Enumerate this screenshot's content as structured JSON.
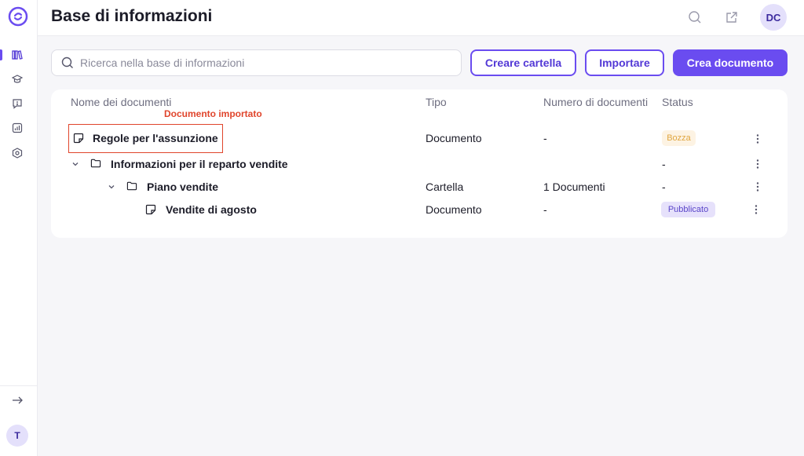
{
  "header": {
    "title": "Base di informazioni",
    "user_initials": "DC"
  },
  "sidebar": {
    "items": [
      {
        "icon": "library-icon",
        "active": true
      },
      {
        "icon": "graduation-cap-icon",
        "active": false
      },
      {
        "icon": "chat-alert-icon",
        "active": false
      },
      {
        "icon": "analytics-icon",
        "active": false
      },
      {
        "icon": "settings-hexagon-icon",
        "active": false
      }
    ],
    "expand_icon": "arrow-right-icon",
    "avatar_initial": "T"
  },
  "toolbar": {
    "search_placeholder": "Ricerca nella base di informazioni",
    "create_folder_label": "Creare cartella",
    "import_label": "Importare",
    "create_document_label": "Crea documento"
  },
  "table": {
    "columns": [
      "Nome dei documenti",
      "Tipo",
      "Numero di documenti",
      "Status"
    ],
    "annotation": "Documento importato",
    "rows": [
      {
        "name": "Regole per l'assunzione",
        "icon": "document-icon",
        "type": "Documento",
        "count": "-",
        "status": "Bozza"
      },
      {
        "name": "Informazioni per il reparto vendite",
        "icon": "folder-icon",
        "type": "",
        "count": "",
        "status": "-"
      },
      {
        "name": "Piano vendite",
        "icon": "folder-icon",
        "type": "Cartella",
        "count": "1 Documenti",
        "status": "-"
      },
      {
        "name": "Vendite di agosto",
        "icon": "document-icon",
        "type": "Documento",
        "count": "-",
        "status": "Pubblicato"
      }
    ]
  },
  "colors": {
    "accent": "#6a4cf0",
    "annotation": "#e0452c",
    "draft_bg": "#fdf3e3",
    "draft_text": "#e0a640",
    "published_bg": "#e6e1fb",
    "published_text": "#5a45c9"
  }
}
